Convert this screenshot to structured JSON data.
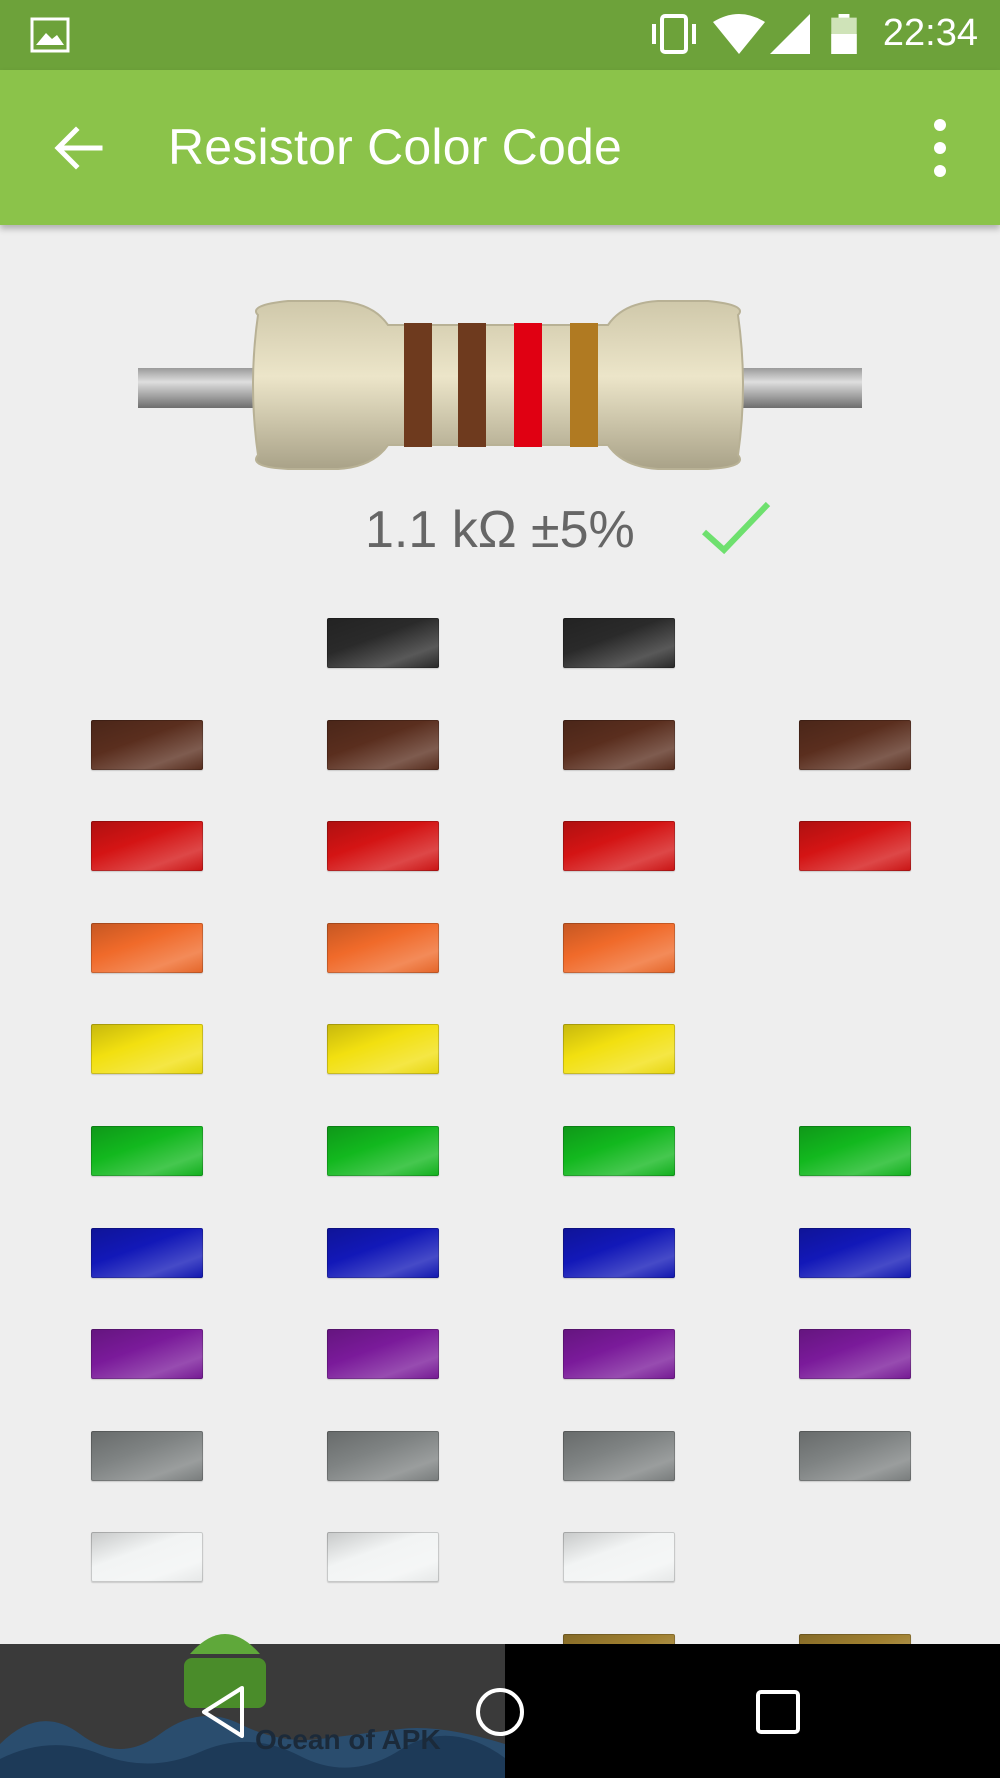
{
  "status_bar": {
    "time": "22:34",
    "icons": [
      "image-icon",
      "vibrate-icon",
      "wifi-icon",
      "signal-icon",
      "battery-icon"
    ]
  },
  "app_bar": {
    "title": "Resistor Color Code",
    "back_icon": "arrow-back-icon",
    "menu_icon": "more-vert-icon",
    "color": "#8bc34a"
  },
  "resistor": {
    "bands": [
      "brown",
      "brown",
      "red",
      "gold"
    ],
    "value_text": "1.1 kΩ ±5%",
    "valid_icon": "check-icon"
  },
  "color_grid": {
    "columns": [
      {
        "name": "band-1",
        "colors": [
          "",
          "brown",
          "red",
          "orange",
          "yellow",
          "green",
          "blue",
          "violet",
          "grey",
          "white",
          ""
        ]
      },
      {
        "name": "band-2",
        "colors": [
          "black",
          "brown",
          "red",
          "orange",
          "yellow",
          "green",
          "blue",
          "violet",
          "grey",
          "white",
          ""
        ]
      },
      {
        "name": "multiplier",
        "colors": [
          "black",
          "brown",
          "red",
          "orange",
          "yellow",
          "green",
          "blue",
          "violet",
          "grey",
          "white",
          "gold"
        ]
      },
      {
        "name": "tolerance",
        "colors": [
          "",
          "brown",
          "red",
          "",
          "",
          "green",
          "blue",
          "violet",
          "grey",
          "",
          "gold"
        ]
      }
    ],
    "palette": {
      "black": "#2a2a2a",
      "brown": "#5a2e1e",
      "red": "#d41414",
      "orange": "#f06a2a",
      "yellow": "#f2e010",
      "green": "#12b81e",
      "blue": "#1218b8",
      "violet": "#7a1a9a",
      "grey": "#7e8282",
      "white": "#f2f4f4",
      "gold": "#a08030"
    }
  },
  "watermark": {
    "text": "Ocean of APK"
  },
  "nav_bar": {
    "back_icon": "nav-back-icon",
    "home_icon": "nav-home-icon",
    "recents_icon": "nav-recents-icon"
  }
}
